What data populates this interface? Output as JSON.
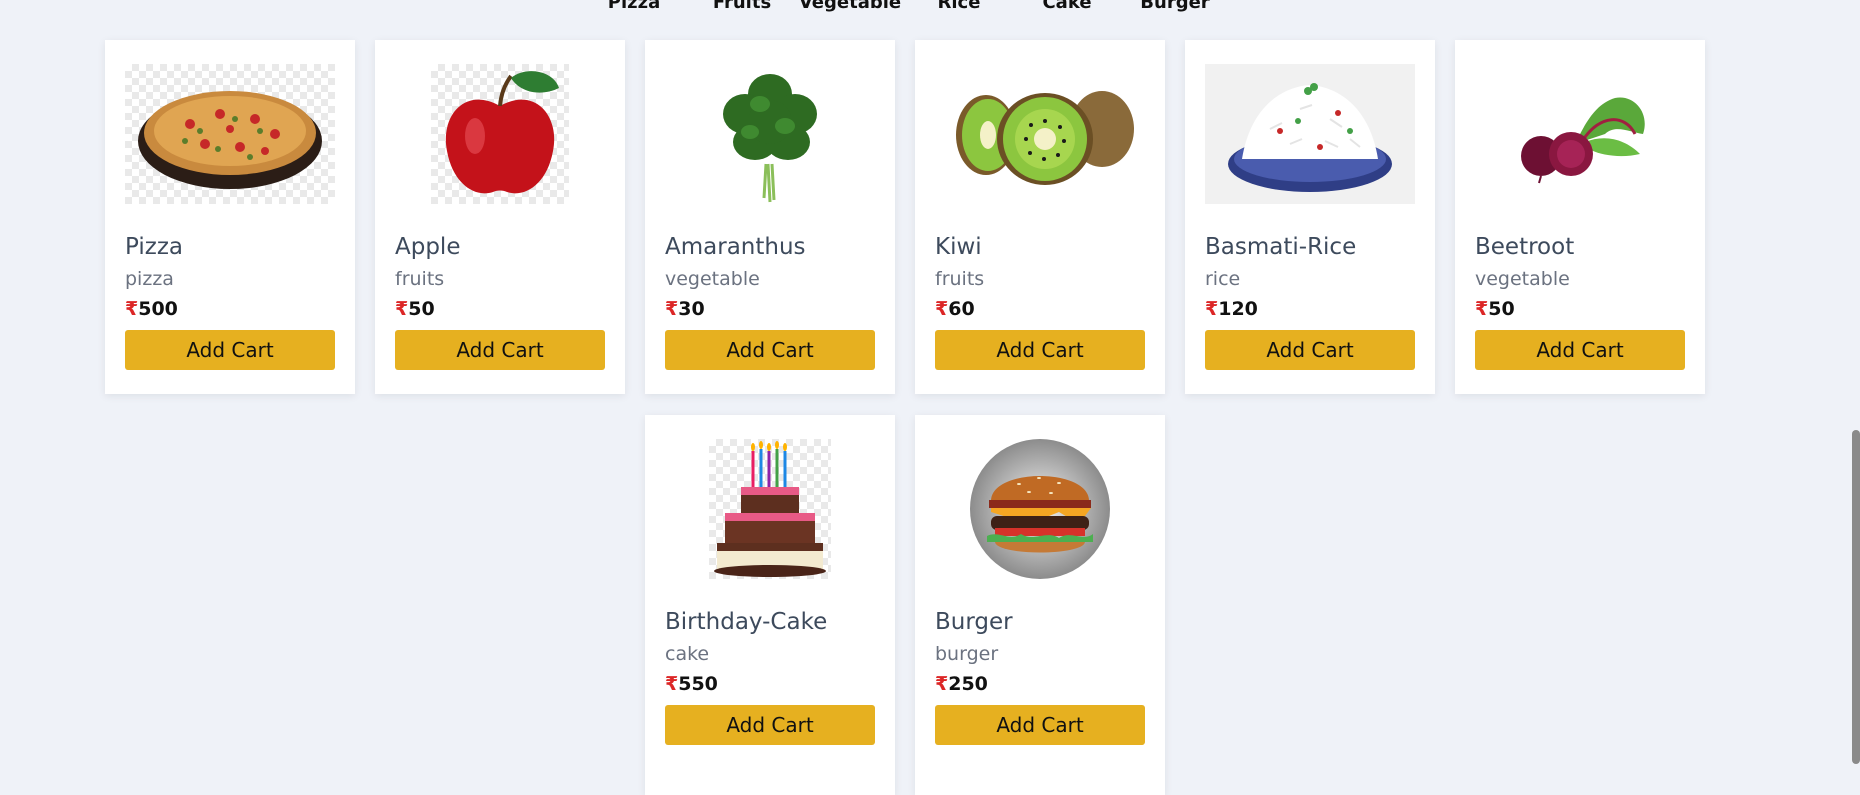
{
  "categories": [
    "Pizza",
    "Fruits",
    "Vegetable",
    "Rice",
    "Cake",
    "Burger"
  ],
  "currency_symbol": "₹",
  "products": [
    {
      "name": "Pizza",
      "category": "pizza",
      "price": "500",
      "button": "Add Cart",
      "image": "pizza-image"
    },
    {
      "name": "Apple",
      "category": "fruits",
      "price": "50",
      "button": "Add Cart",
      "image": "apple-image"
    },
    {
      "name": "Amaranthus",
      "category": "vegetable",
      "price": "30",
      "button": "Add Cart",
      "image": "amaranthus-image"
    },
    {
      "name": "Kiwi",
      "category": "fruits",
      "price": "60",
      "button": "Add Cart",
      "image": "kiwi-image"
    },
    {
      "name": "Basmati-Rice",
      "category": "rice",
      "price": "120",
      "button": "Add Cart",
      "image": "rice-image"
    },
    {
      "name": "Beetroot",
      "category": "vegetable",
      "price": "50",
      "button": "Add Cart",
      "image": "beetroot-image"
    },
    {
      "name": "Birthday-Cake",
      "category": "cake",
      "price": "550",
      "button": "Add Cart",
      "image": "cake-image"
    },
    {
      "name": "Burger",
      "category": "burger",
      "price": "250",
      "button": "Add Cart",
      "image": "burger-image"
    }
  ],
  "colors": {
    "accent": "#e6b020",
    "rupee": "#dc2626",
    "background": "#eff2f8"
  }
}
